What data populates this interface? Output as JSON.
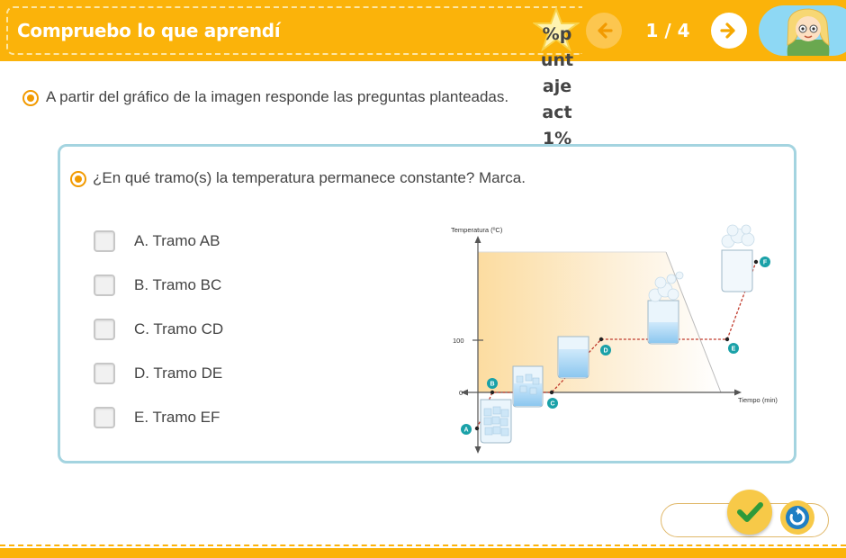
{
  "header": {
    "title": "Compruebo lo que aprendí",
    "score_text": "%puntajeact1%",
    "page_indicator": "1 / 4",
    "icons": {
      "prev": "arrow-left-icon",
      "next": "arrow-right-icon",
      "star": "star-icon",
      "avatar": "character-avatar"
    },
    "colors": {
      "bar": "#fbb30a",
      "prev_button": "#fcc64f",
      "next_button": "#ffffff"
    }
  },
  "instruction": "A partir del gráfico de la imagen responde las preguntas planteadas.",
  "question": {
    "text": "¿En qué tramo(s) la temperatura permanece constante? Marca.",
    "options": [
      {
        "label": "A. Tramo AB",
        "checked": false
      },
      {
        "label": "B. Tramo BC",
        "checked": false
      },
      {
        "label": "C. Tramo CD",
        "checked": false
      },
      {
        "label": "D. Tramo DE",
        "checked": false
      },
      {
        "label": "E. Tramo EF",
        "checked": false
      }
    ]
  },
  "figure": {
    "y_axis_label": "Temperatura (ºC)",
    "x_axis_label": "Tiempo (min)",
    "tick_100": "100",
    "tick_0": "0",
    "points": [
      "A",
      "B",
      "C",
      "D",
      "E",
      "F"
    ]
  },
  "footer": {
    "icons": {
      "check": "checkmark-icon",
      "retry": "refresh-icon"
    },
    "accent": "#f7c948"
  }
}
